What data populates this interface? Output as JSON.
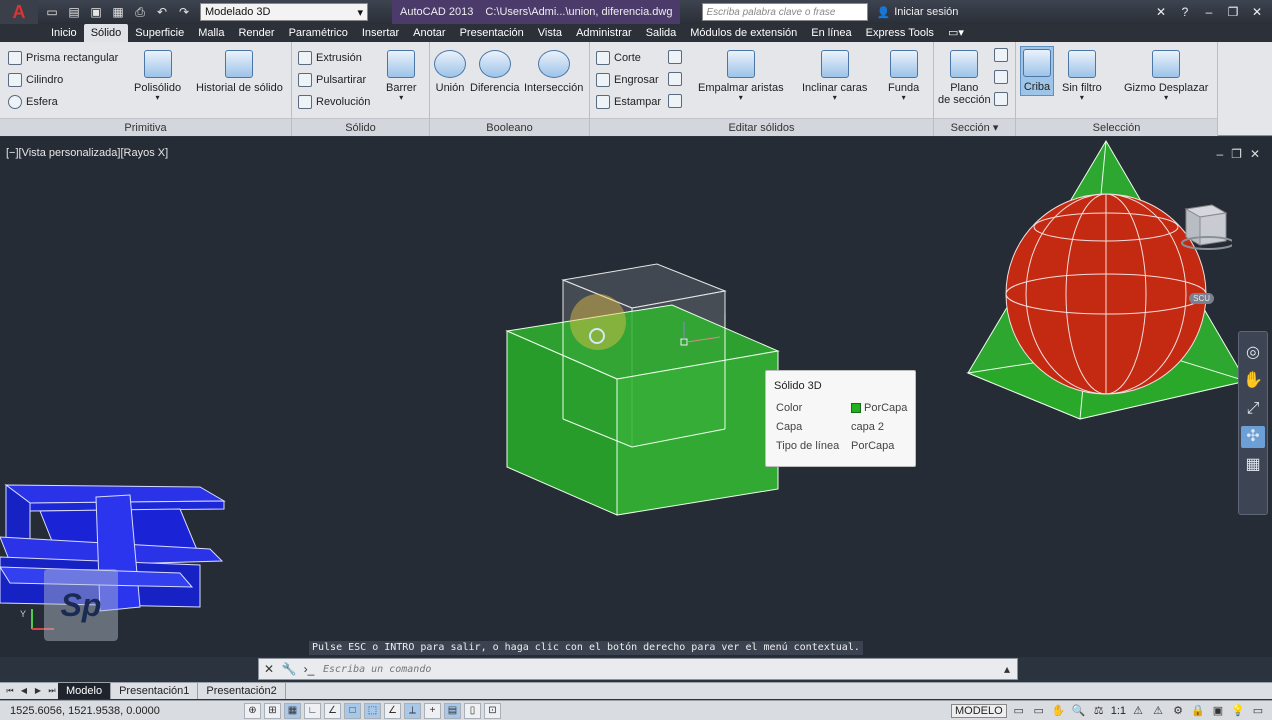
{
  "titlebar": {
    "workspace": "Modelado 3D",
    "app_name": "AutoCAD 2013",
    "file_path": "C:\\Users\\Admi...\\union, diferencia.dwg",
    "search_placeholder": "Escriba palabra clave o frase",
    "signin_label": "Iniciar sesión"
  },
  "tabs": [
    "Inicio",
    "Sólido",
    "Superficie",
    "Malla",
    "Render",
    "Paramétrico",
    "Insertar",
    "Anotar",
    "Presentación",
    "Vista",
    "Administrar",
    "Salida",
    "Módulos de extensión",
    "En línea",
    "Express Tools"
  ],
  "active_tab": "Sólido",
  "ribbon": {
    "primitiva": {
      "title": "Primitiva",
      "small": [
        "Prisma rectangular",
        "Cilindro",
        "Esfera"
      ],
      "big": [
        "Polisólido",
        "Historial de sólido"
      ]
    },
    "solido": {
      "title": "Sólido",
      "small": [
        "Extrusión",
        "Pulsartirar",
        "Revolución"
      ],
      "big": [
        "Barrer"
      ]
    },
    "booleano": {
      "title": "Booleano",
      "big": [
        "Unión",
        "Diferencia",
        "Intersección"
      ]
    },
    "editar": {
      "title": "Editar sólidos",
      "small": [
        "Corte",
        "Engrosar",
        "Estampar"
      ],
      "big": [
        "Empalmar aristas",
        "Inclinar caras",
        "Funda"
      ]
    },
    "seccion": {
      "title": "Sección",
      "big_line1": "Plano",
      "big_line2": "de sección"
    },
    "seleccion": {
      "title": "Selección",
      "big": [
        "Criba",
        "Sin filtro",
        "Gizmo Desplazar"
      ]
    }
  },
  "viewport": {
    "label": "[−][Vista personalizada][Rayos X]",
    "wcs": "SCU"
  },
  "tooltip": {
    "title": "Sólido 3D",
    "rows": [
      {
        "key": "Color",
        "value": "PorCapa"
      },
      {
        "key": "Capa",
        "value": "capa 2"
      },
      {
        "key": "Tipo de línea",
        "value": "PorCapa"
      }
    ]
  },
  "logo_text": "Sp",
  "command": {
    "message": "Pulse ESC o INTRO para salir, o haga clic con el botón derecho para ver el menú contextual.",
    "placeholder": "Escriba un comando"
  },
  "layout_tabs": [
    "Modelo",
    "Presentación1",
    "Presentación2"
  ],
  "status": {
    "coords": "1525.6056, 1521.9538, 0.0000",
    "space": "MODELO",
    "scale": "1:1"
  },
  "colors": {
    "green_solid": "#2fb52f",
    "red_sphere": "#c42a12",
    "blue_beams": "#1b23d6",
    "viewport_bg": "#262c35"
  }
}
